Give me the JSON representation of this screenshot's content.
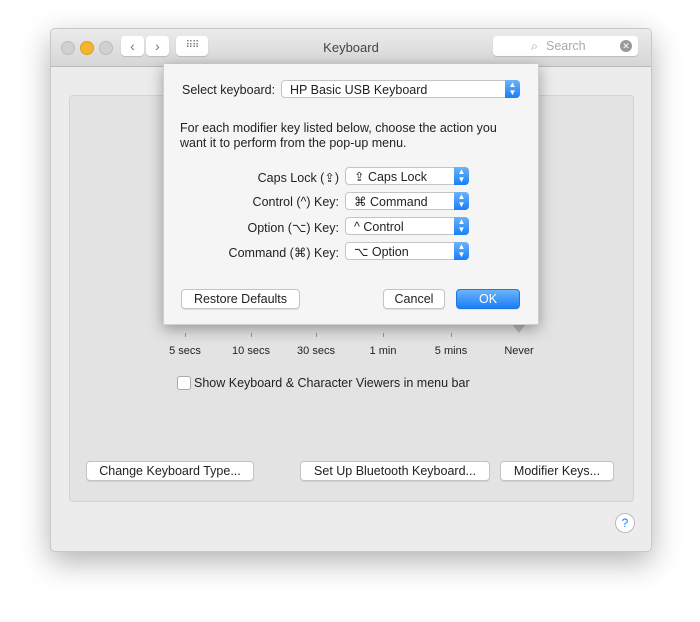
{
  "window": {
    "title": "Keyboard",
    "search_placeholder": "Search"
  },
  "slider": {
    "labels": [
      "5 secs",
      "10 secs",
      "30 secs",
      "1 min",
      "5 mins",
      "Never"
    ],
    "selected": "Never"
  },
  "checkbox": {
    "label": "Show Keyboard & Character Viewers in menu bar",
    "checked": false
  },
  "buttons": {
    "change_type": "Change Keyboard Type...",
    "bluetooth": "Set Up Bluetooth Keyboard...",
    "modifier": "Modifier Keys...",
    "help": "?"
  },
  "sheet": {
    "select_label": "Select keyboard:",
    "select_value": "HP Basic USB Keyboard",
    "description": [
      "For each modifier key listed below, choose the action you",
      "want it to perform from the pop-up menu."
    ],
    "rows": [
      {
        "label": "Caps Lock (⇪)",
        "value": "⇪ Caps Lock"
      },
      {
        "label": "Control (^) Key:",
        "value": "⌘ Command"
      },
      {
        "label": "Option (⌥) Key:",
        "value": "^ Control"
      },
      {
        "label": "Command (⌘) Key:",
        "value": "⌥ Option"
      }
    ],
    "restore": "Restore Defaults",
    "cancel": "Cancel",
    "ok": "OK"
  },
  "colors": {
    "accent": "#1a7ff5"
  }
}
